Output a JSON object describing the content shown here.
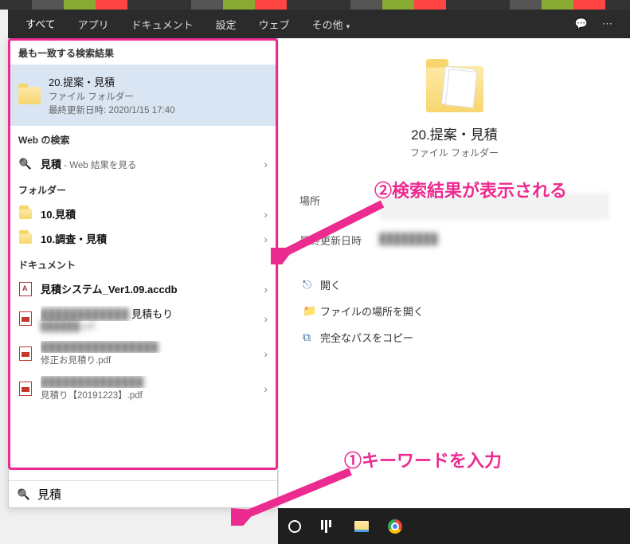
{
  "tabs": {
    "items": [
      {
        "label": "すべて",
        "active": true
      },
      {
        "label": "アプリ"
      },
      {
        "label": "ドキュメント"
      },
      {
        "label": "設定"
      },
      {
        "label": "ウェブ"
      },
      {
        "label": "その他"
      }
    ]
  },
  "sections": {
    "best_match": "最も一致する検索結果",
    "web": "Web の検索",
    "folders": "フォルダー",
    "documents": "ドキュメント"
  },
  "best_match_item": {
    "title": "20.提案・見積",
    "subtitle": "ファイル フォルダー",
    "updated_label": "最終更新日時: 2020/1/15 17:40"
  },
  "web_search": {
    "term": "見積",
    "suffix": " - Web 結果を見る"
  },
  "folders": [
    {
      "title": "10.見積"
    },
    {
      "title": "10.調査・見積"
    }
  ],
  "documents": [
    {
      "title": "見積システム_Ver1.09.accdb",
      "type": "accdb"
    },
    {
      "title_obscured": "████████████",
      "title2": "見積もり",
      "sub": "██████.pdf",
      "type": "pdf"
    },
    {
      "title_obscured": "████████████████",
      "sub": "修正お見積り.pdf",
      "type": "pdf"
    },
    {
      "title_obscured": "██████████████",
      "sub": "見積り【20191223】.pdf",
      "type": "pdf"
    }
  ],
  "detail": {
    "title": "20.提案・見積",
    "subtitle": "ファイル フォルダー",
    "location_label": "場所",
    "updated_label": "最終更新日時"
  },
  "actions": {
    "open": "開く",
    "open_location": "ファイルの場所を開く",
    "copy_path": "完全なパスをコピー"
  },
  "search_input": {
    "value": "見積"
  },
  "callouts": {
    "c1": "①キーワードを入力",
    "c2": "②検索結果が表示される"
  }
}
